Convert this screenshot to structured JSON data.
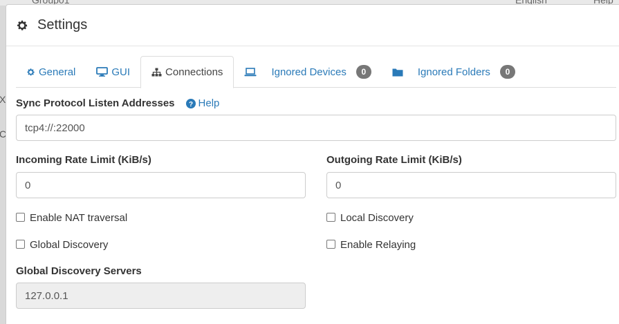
{
  "background": {
    "top_left_text": "Group01",
    "top_lang": "English",
    "top_help": "Help",
    "left_chars": [
      "X",
      "C"
    ]
  },
  "header": {
    "icon": "gear-icon",
    "title": "Settings"
  },
  "tabs": [
    {
      "icon": "gear-icon",
      "label": "General",
      "active": false
    },
    {
      "icon": "monitor-icon",
      "label": "GUI",
      "active": false
    },
    {
      "icon": "sitemap-icon",
      "label": "Connections",
      "active": true
    },
    {
      "icon": "laptop-icon",
      "label": "Ignored Devices",
      "badge": "0",
      "active": false
    },
    {
      "icon": "folder-icon",
      "label": "Ignored Folders",
      "badge": "0",
      "active": false
    }
  ],
  "connections": {
    "listen_label": "Sync Protocol Listen Addresses",
    "help_label": "Help",
    "listen_value": "tcp4://:22000",
    "incoming_label": "Incoming Rate Limit (KiB/s)",
    "incoming_value": "0",
    "outgoing_label": "Outgoing Rate Limit (KiB/s)",
    "outgoing_value": "0",
    "nat_label": "Enable NAT traversal",
    "nat_checked": false,
    "local_discovery_label": "Local Discovery",
    "local_discovery_checked": false,
    "global_discovery_label": "Global Discovery",
    "global_discovery_checked": false,
    "relaying_label": "Enable Relaying",
    "relaying_checked": false,
    "servers_label": "Global Discovery Servers",
    "servers_value": "127.0.0.1"
  },
  "colors": {
    "link": "#2a7ab8",
    "badge": "#777777",
    "readonly_bg": "#eeeeee"
  }
}
